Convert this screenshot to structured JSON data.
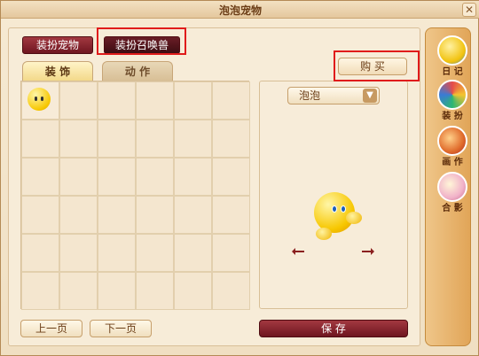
{
  "window": {
    "title": "泡泡宠物",
    "close_glyph": "✕"
  },
  "top_buttons": {
    "dress_pet": "装扮宠物",
    "dress_summon": "装扮召唤兽"
  },
  "tabs": {
    "decoration": "装 饰",
    "action": "动 作"
  },
  "grid": {
    "rows": 6,
    "cols": 6,
    "items": [
      {
        "name": "pet-bubble",
        "slot": 0
      }
    ]
  },
  "pager": {
    "prev": "上一页",
    "next": "下一页"
  },
  "preview": {
    "buy": "购 买",
    "select_value": "泡泡",
    "save": "保 存"
  },
  "side": {
    "diary": "日 记",
    "dress": "装 扮",
    "works": "画 作",
    "photo": "合 影"
  },
  "colors": {
    "accent": "#7b1d2a",
    "highlight": "#e01b1b"
  }
}
